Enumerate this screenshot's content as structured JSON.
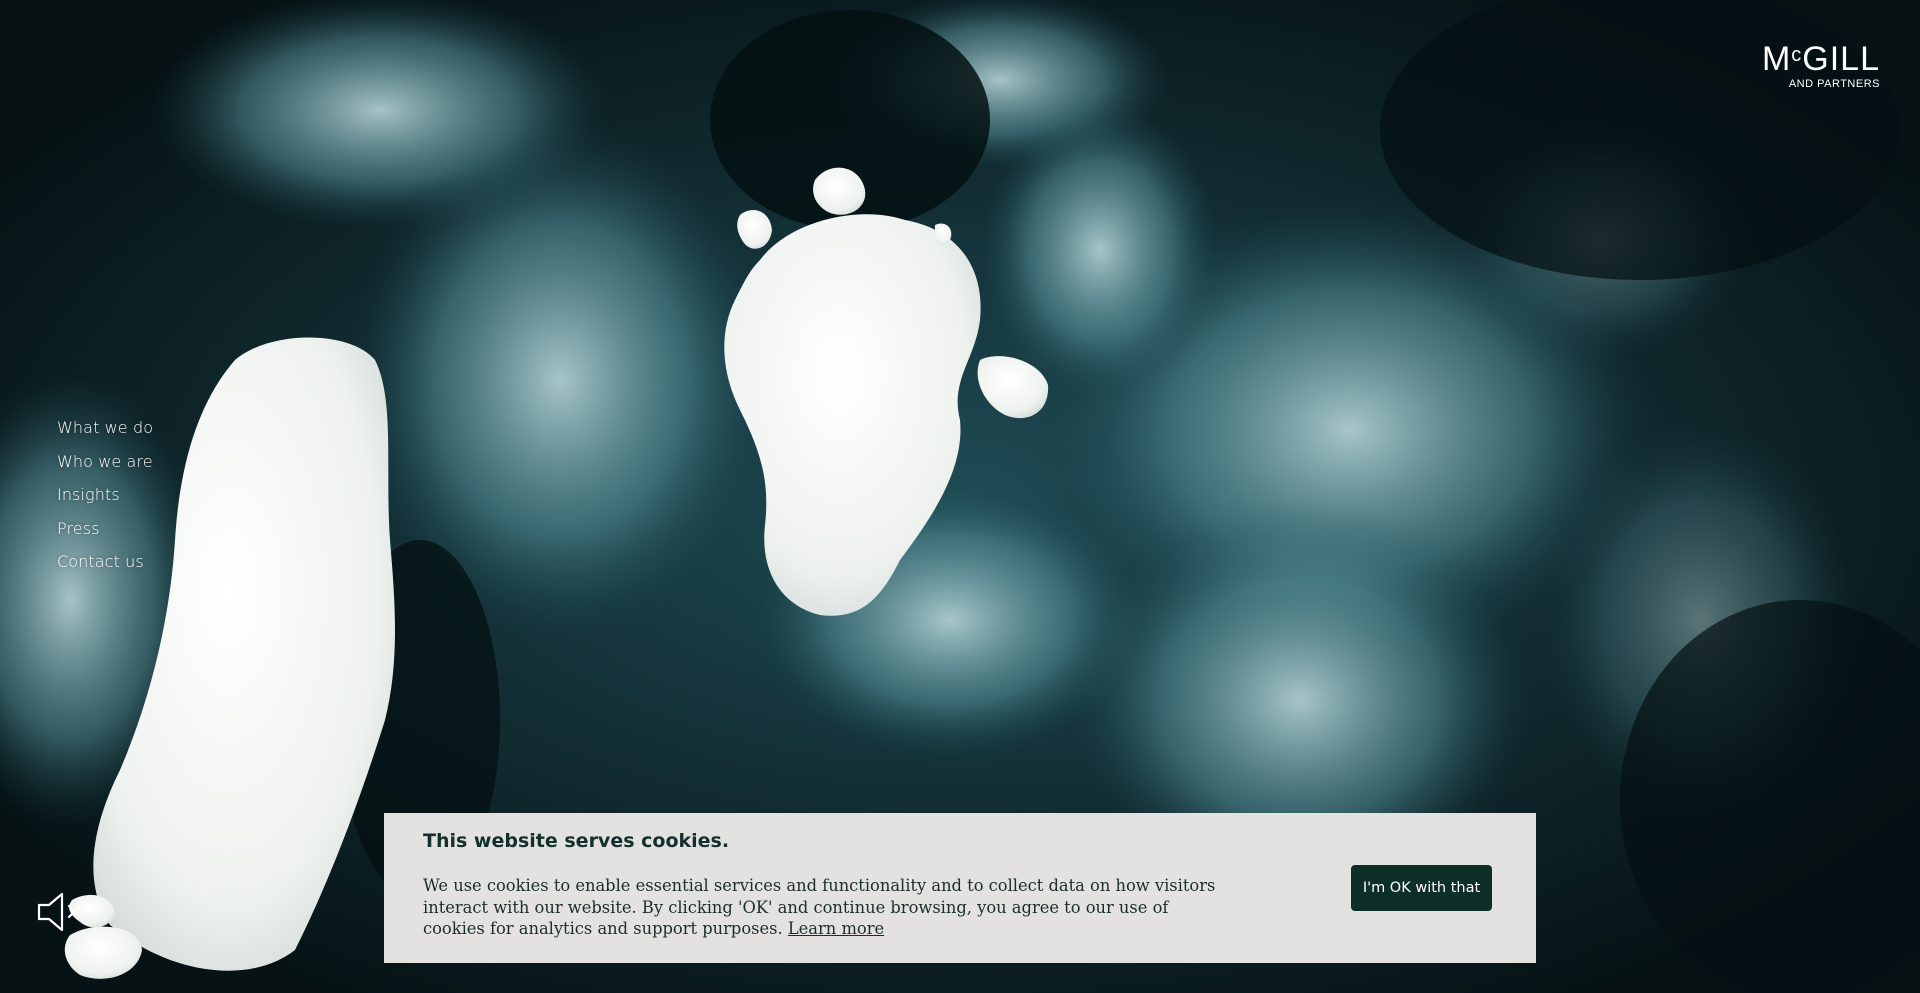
{
  "brand": {
    "logo_main_prefix": "M",
    "logo_main_small": "c",
    "logo_main_rest": "GILL",
    "logo_sub": "AND PARTNERS"
  },
  "nav": {
    "items": [
      {
        "label": "What we do"
      },
      {
        "label": "Who we are"
      },
      {
        "label": "Insights"
      },
      {
        "label": "Press"
      },
      {
        "label": "Contact us"
      }
    ]
  },
  "media": {
    "mute_icon": "speaker-muted-icon",
    "background": "aerial-ocean-ice-video"
  },
  "cookie": {
    "title": "This website serves cookies.",
    "text": "We use cookies to enable essential services and functionality and to collect data on how visitors interact with our website. By clicking 'OK' and continue browsing, you agree to our use of cookies for analytics and support purposes.",
    "learn_more": "Learn more",
    "accept_label": "I'm OK with that"
  },
  "colors": {
    "banner_bg": "#e3e2e1",
    "button_bg": "#0e2e28",
    "ocean_dark": "#0b1a1c",
    "ocean_teal": "#2f6b72",
    "ice": "#f2f4f1"
  }
}
